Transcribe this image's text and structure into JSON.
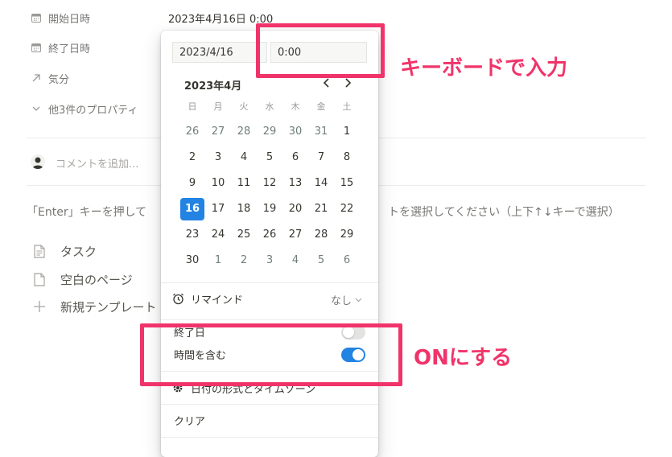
{
  "properties": [
    {
      "label": "開始日時",
      "icon": "calendar-icon",
      "value": "2023年4月16日 0:00"
    },
    {
      "label": "終了日時",
      "icon": "calendar-icon",
      "value": ""
    },
    {
      "label": "気分",
      "icon": "arrow-up-right-icon",
      "value": ""
    },
    {
      "label": "他3件のプロパティ",
      "icon": "chevron-down-icon",
      "value": ""
    }
  ],
  "comment": {
    "placeholder": "コメントを追加..."
  },
  "hint": {
    "left": "「Enter」キーを押して",
    "right": "トを選択してください（上下↑↓キーで選択）"
  },
  "templates": [
    {
      "label": "タスク",
      "icon": "document-lines-icon"
    },
    {
      "label": "空白のページ",
      "icon": "document-icon"
    },
    {
      "label": "新規テンプレート",
      "icon": "plus-icon"
    }
  ],
  "picker": {
    "date_value": "2023/4/16",
    "time_value": "0:00",
    "month_label": "2023年4月",
    "weekdays": [
      "日",
      "月",
      "火",
      "水",
      "木",
      "金",
      "土"
    ],
    "weeks": [
      [
        "26",
        "27",
        "28",
        "29",
        "30",
        "31",
        "1"
      ],
      [
        "2",
        "3",
        "4",
        "5",
        "6",
        "7",
        "8"
      ],
      [
        "9",
        "10",
        "11",
        "12",
        "13",
        "14",
        "15"
      ],
      [
        "16",
        "17",
        "18",
        "19",
        "20",
        "21",
        "22"
      ],
      [
        "23",
        "24",
        "25",
        "26",
        "27",
        "28",
        "29"
      ],
      [
        "30",
        "1",
        "2",
        "3",
        "4",
        "5",
        "6"
      ]
    ],
    "selected_day": "16",
    "remind_label": "リマインド",
    "remind_value": "なし",
    "end_date_label": "終了日",
    "end_date_on": false,
    "include_time_label": "時間を含む",
    "include_time_on": true,
    "format_label": "日付の形式とタイムゾーン",
    "clear_label": "クリア"
  },
  "annotations": {
    "keyboard": "キーボードで入力",
    "on": "ONにする"
  },
  "colors": {
    "accent": "#2383e2",
    "annotation": "#f0346a"
  }
}
